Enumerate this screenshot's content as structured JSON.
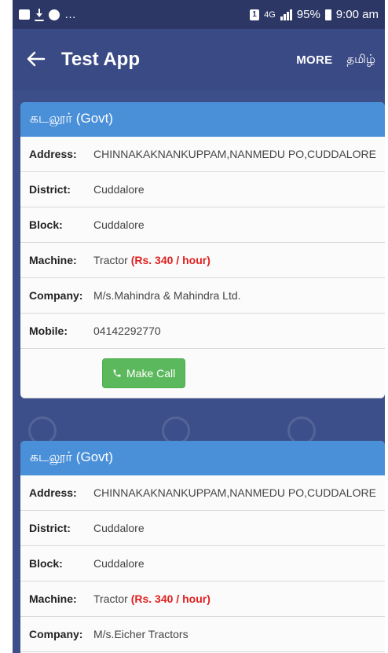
{
  "status_bar": {
    "dots": "…",
    "sim": "1",
    "network": "4G",
    "battery": "95%",
    "time": "9:00 am"
  },
  "app_bar": {
    "title": "Test App",
    "more_label": "MORE",
    "language_label": "தமிழ்"
  },
  "cards": [
    {
      "header": "கடலூர் (Govt)",
      "rows": [
        {
          "label": "Address:",
          "value": "CHINNAKAKNANKUPPAM,NANMEDU PO,CUDDALORE"
        },
        {
          "label": "District:",
          "value": "Cuddalore"
        },
        {
          "label": "Block:",
          "value": "Cuddalore"
        },
        {
          "label": "Machine:",
          "value": "Tractor",
          "rate": "(Rs. 340 / hour)"
        },
        {
          "label": "Company:",
          "value": "M/s.Mahindra & Mahindra Ltd."
        },
        {
          "label": "Mobile:",
          "value": "04142292770"
        }
      ],
      "call_label": "Make Call"
    },
    {
      "header": "கடலூர் (Govt)",
      "rows": [
        {
          "label": "Address:",
          "value": "CHINNAKAKNANKUPPAM,NANMEDU PO,CUDDALORE"
        },
        {
          "label": "District:",
          "value": "Cuddalore"
        },
        {
          "label": "Block:",
          "value": "Cuddalore"
        },
        {
          "label": "Machine:",
          "value": "Tractor",
          "rate": "(Rs. 340 / hour)"
        },
        {
          "label": "Company:",
          "value": "M/s.Eicher Tractors"
        }
      ]
    }
  ],
  "colors": {
    "background": "#3d4f8a",
    "app_bar": "#3a4a85",
    "card_header": "#4a90d9",
    "rate": "#e02020",
    "call_button": "#5cb85c"
  }
}
